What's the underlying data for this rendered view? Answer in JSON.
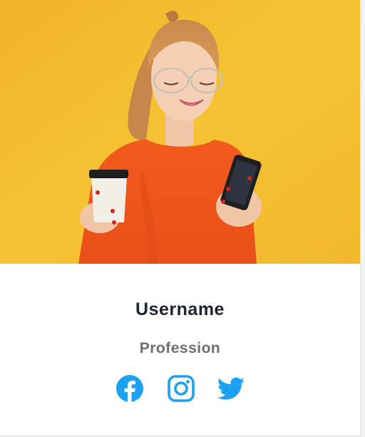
{
  "profile": {
    "username": "Username",
    "profession": "Profession"
  },
  "social": {
    "icons": [
      "facebook-icon",
      "instagram-icon",
      "twitter-icon"
    ],
    "color": "#1da1f2"
  },
  "colors": {
    "photo_background": "#f5bd2a",
    "username_text": "#1d2333",
    "profession_text": "#6e6e6e"
  }
}
